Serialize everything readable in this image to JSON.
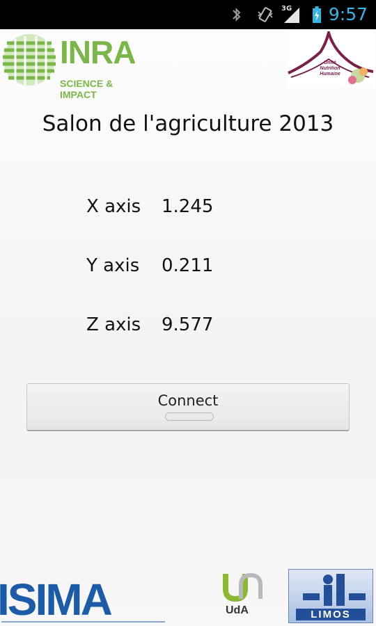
{
  "status_bar": {
    "network_type": "3G",
    "time": "9:57",
    "icons": [
      "bluetooth-icon",
      "vibrate-icon",
      "signal-icon",
      "battery-charging-icon"
    ],
    "accent_color": "#33b5e5"
  },
  "logos": {
    "inra": {
      "name": "INRA",
      "tagline": "SCIENCE & IMPACT",
      "color": "#7ab648"
    },
    "unh": {
      "text_lines": [
        "Unité",
        "Nutrition",
        "Humaine"
      ]
    },
    "isima": {
      "name": "ISIMA",
      "color": "#1c5ba8"
    },
    "uda": {
      "name": "UdA"
    },
    "limos": {
      "name": "LIMOS",
      "color": "#234e98"
    }
  },
  "title": "Salon de l'agriculture 2013",
  "axes": [
    {
      "label": "X axis",
      "value": "1.245"
    },
    {
      "label": "Y axis",
      "value": "0.211"
    },
    {
      "label": "Z axis",
      "value": "9.577"
    }
  ],
  "connect_button": {
    "label": "Connect"
  }
}
